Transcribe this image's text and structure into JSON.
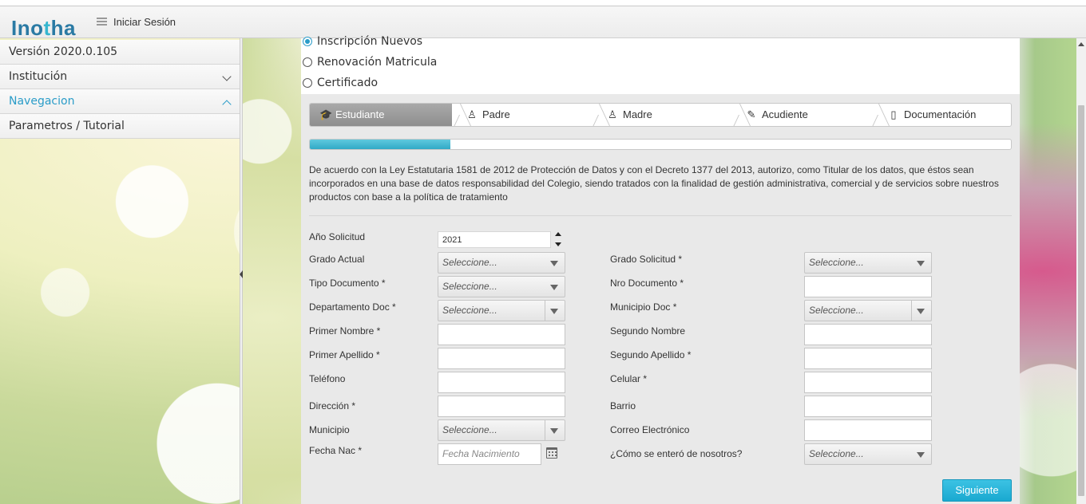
{
  "header": {
    "logo_prefix": "Ino",
    "logo_accent": "t",
    "logo_suffix": "ha",
    "menu_icon": "hamburger-icon",
    "login_label": "Iniciar Sesión"
  },
  "sidebar": {
    "items": [
      {
        "label": "Versión 2020.0.105"
      },
      {
        "label": "Institución"
      },
      {
        "label": "Navegacion"
      },
      {
        "label": "Parametros / Tutorial"
      }
    ]
  },
  "registration_type": {
    "options": [
      "Inscripción Nuevos",
      "Renovación Matricula",
      "Certificado"
    ],
    "selected": "Inscripción Nuevos"
  },
  "wizard": {
    "steps": [
      {
        "label": "Estudiante",
        "icon": "graduation-cap-icon"
      },
      {
        "label": "Padre",
        "icon": "user-icon"
      },
      {
        "label": "Madre",
        "icon": "user-icon"
      },
      {
        "label": "Acudiente",
        "icon": "pencil-icon"
      },
      {
        "label": "Documentación",
        "icon": "document-icon"
      }
    ],
    "active_step": "Estudiante",
    "progress_fraction": 0.2
  },
  "consent_text": "De acuerdo con la Ley Estatutaria 1581 de 2012 de Protección de Datos y con el Decreto 1377 del 2013, autorizo, como Titular de los datos, que éstos sean incorporados en una base de datos responsabilidad del Colegio, siendo tratados con la finalidad de gestión administrativa, comercial y de servicios sobre nuestros productos con base a la política de tratamiento",
  "form": {
    "anio_solicitud_label": "Año Solicitud",
    "anio_solicitud_value": "2021",
    "grado_actual_label": "Grado Actual",
    "grado_solicitud_label": "Grado Solicitud *",
    "tipo_documento_label": "Tipo Documento *",
    "nro_documento_label": "Nro Documento *",
    "departamento_doc_label": "Departamento Doc *",
    "municipio_doc_label": "Municipio Doc *",
    "primer_nombre_label": "Primer Nombre *",
    "segundo_nombre_label": "Segundo Nombre",
    "primer_apellido_label": "Primer Apellido *",
    "segundo_apellido_label": "Segundo Apellido *",
    "telefono_label": "Teléfono",
    "celular_label": "Celular *",
    "direccion_label": "Dirección *",
    "barrio_label": "Barrio",
    "municipio_label": "Municipio",
    "correo_label": "Correo Electrónico",
    "fecha_nac_label": "Fecha Nac *",
    "fecha_nac_placeholder": "Fecha Nacimiento",
    "como_se_entero_label": "¿Cómo se enteró de nosotros?",
    "select_placeholder": "Seleccione...",
    "next_label": "Siguiente"
  },
  "colors": {
    "accent": "#2a9cc8",
    "progress": "#31a9c6",
    "next_button": "#1aa9d0"
  }
}
